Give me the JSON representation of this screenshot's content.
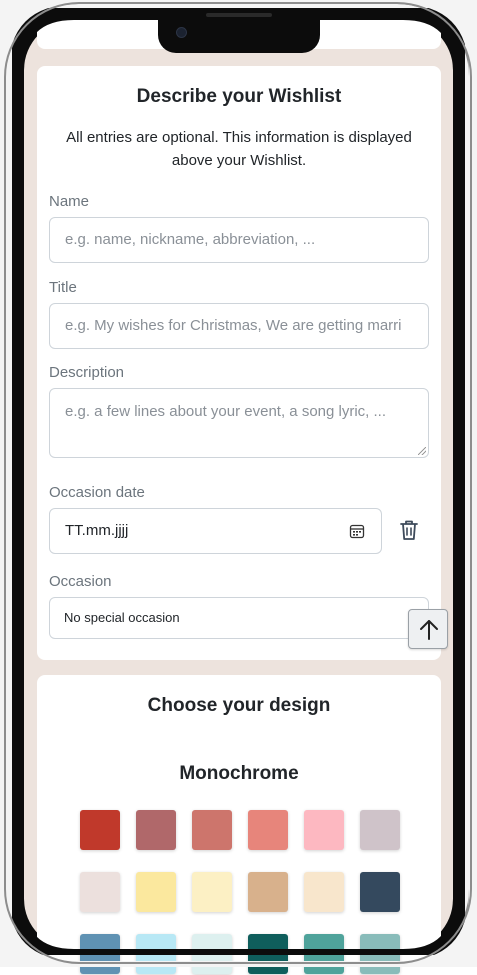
{
  "wishlist_form": {
    "title": "Describe your Wishlist",
    "intro": "All entries are optional. This information is displayed above your Wishlist.",
    "name": {
      "label": "Name",
      "placeholder": "e.g. name, nickname, abbreviation, ..."
    },
    "title_field": {
      "label": "Title",
      "placeholder": "e.g. My wishes for Christmas, We are getting marri"
    },
    "description": {
      "label": "Description",
      "placeholder": "e.g. a few lines about your event, a song lyric, ..."
    },
    "occasion_date": {
      "label": "Occasion date",
      "value": "TT.mm.jjjj"
    },
    "occasion": {
      "label": "Occasion",
      "selected": "No special occasion"
    }
  },
  "design": {
    "title": "Choose your design",
    "palette_name": "Monochrome",
    "swatches": [
      "#c0392b",
      "#b0686a",
      "#cd756c",
      "#e7857b",
      "#fdb8c1",
      "#cfc3c9",
      "#ece0dd",
      "#fbe89e",
      "#fcf0c4",
      "#d8b18c",
      "#f8e6cc",
      "#34495e",
      "#5f92b3",
      "#b8e8f5",
      "#ddf0ef",
      "#0f5e5c",
      "#4fa39b",
      "#89bcba"
    ]
  },
  "icons": {
    "calendar": "calendar-icon",
    "trash": "trash-icon",
    "scroll_top": "arrow-up-icon"
  }
}
